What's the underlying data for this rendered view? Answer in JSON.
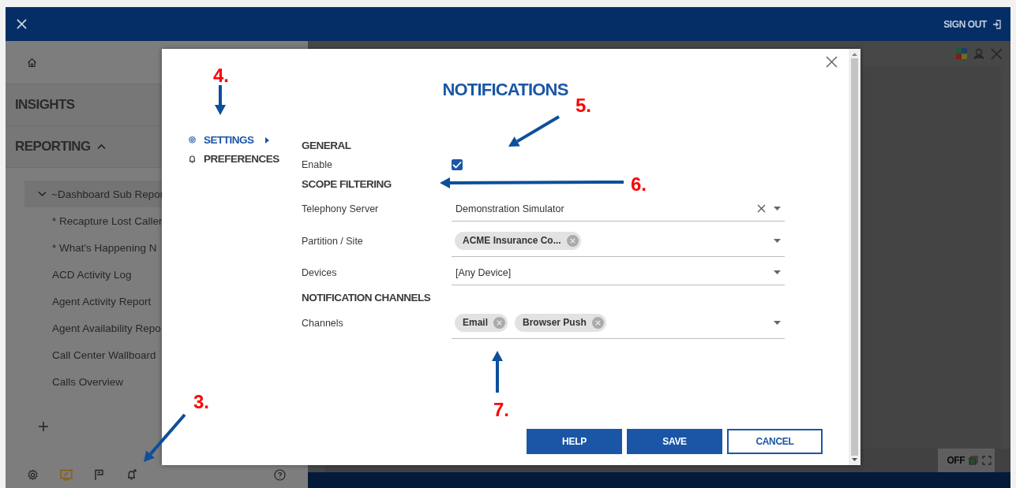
{
  "top_bar": {
    "sign_out": "SIGN OUT"
  },
  "sidebar": {
    "sections": [
      {
        "label": "INSIGHTS",
        "kind": "link"
      },
      {
        "label": "REPORTING",
        "kind": "group",
        "expanded": true
      }
    ],
    "tree": [
      {
        "label": "~Dashboard Sub Repor",
        "expanded": true,
        "children": [
          {
            "label": "* Recapture Lost Caller"
          },
          {
            "label": "* What's Happening N"
          },
          {
            "label": "ACD Activity Log"
          },
          {
            "label": "Agent Activity Report"
          },
          {
            "label": "Agent Availability Repo"
          },
          {
            "label": "Call Center Wallboard"
          },
          {
            "label": "Calls Overview"
          }
        ]
      }
    ]
  },
  "footer": {
    "status": "OFF"
  },
  "dialog": {
    "title": "NOTIFICATIONS",
    "nav": [
      {
        "label": "SETTINGS",
        "selected": true
      },
      {
        "label": "PREFERENCES",
        "selected": false
      }
    ],
    "sections": [
      {
        "title": "GENERAL",
        "rows": [
          {
            "label": "Enable",
            "kind": "checkbox",
            "checked": true
          }
        ]
      },
      {
        "title": "SCOPE FILTERING",
        "rows": [
          {
            "label": "Telephony Server",
            "kind": "select",
            "value": "Demonstration Simulator",
            "clearable": true
          },
          {
            "label": "Partition / Site",
            "kind": "chips",
            "chips": [
              "ACME Insurance Co..."
            ]
          },
          {
            "label": "Devices",
            "kind": "select",
            "value": "[Any Device]",
            "clearable": false
          }
        ]
      },
      {
        "title": "NOTIFICATION CHANNELS",
        "rows": [
          {
            "label": "Channels",
            "kind": "chips",
            "chips": [
              "Email",
              "Browser Push"
            ]
          }
        ]
      }
    ],
    "buttons": [
      {
        "label": "HELP",
        "kind": "primary"
      },
      {
        "label": "SAVE",
        "kind": "primary"
      },
      {
        "label": "CANCEL",
        "kind": "secondary"
      }
    ]
  },
  "annotations": [
    {
      "label": "4."
    },
    {
      "label": "5."
    },
    {
      "label": "6."
    },
    {
      "label": "7."
    },
    {
      "label": "3."
    }
  ]
}
